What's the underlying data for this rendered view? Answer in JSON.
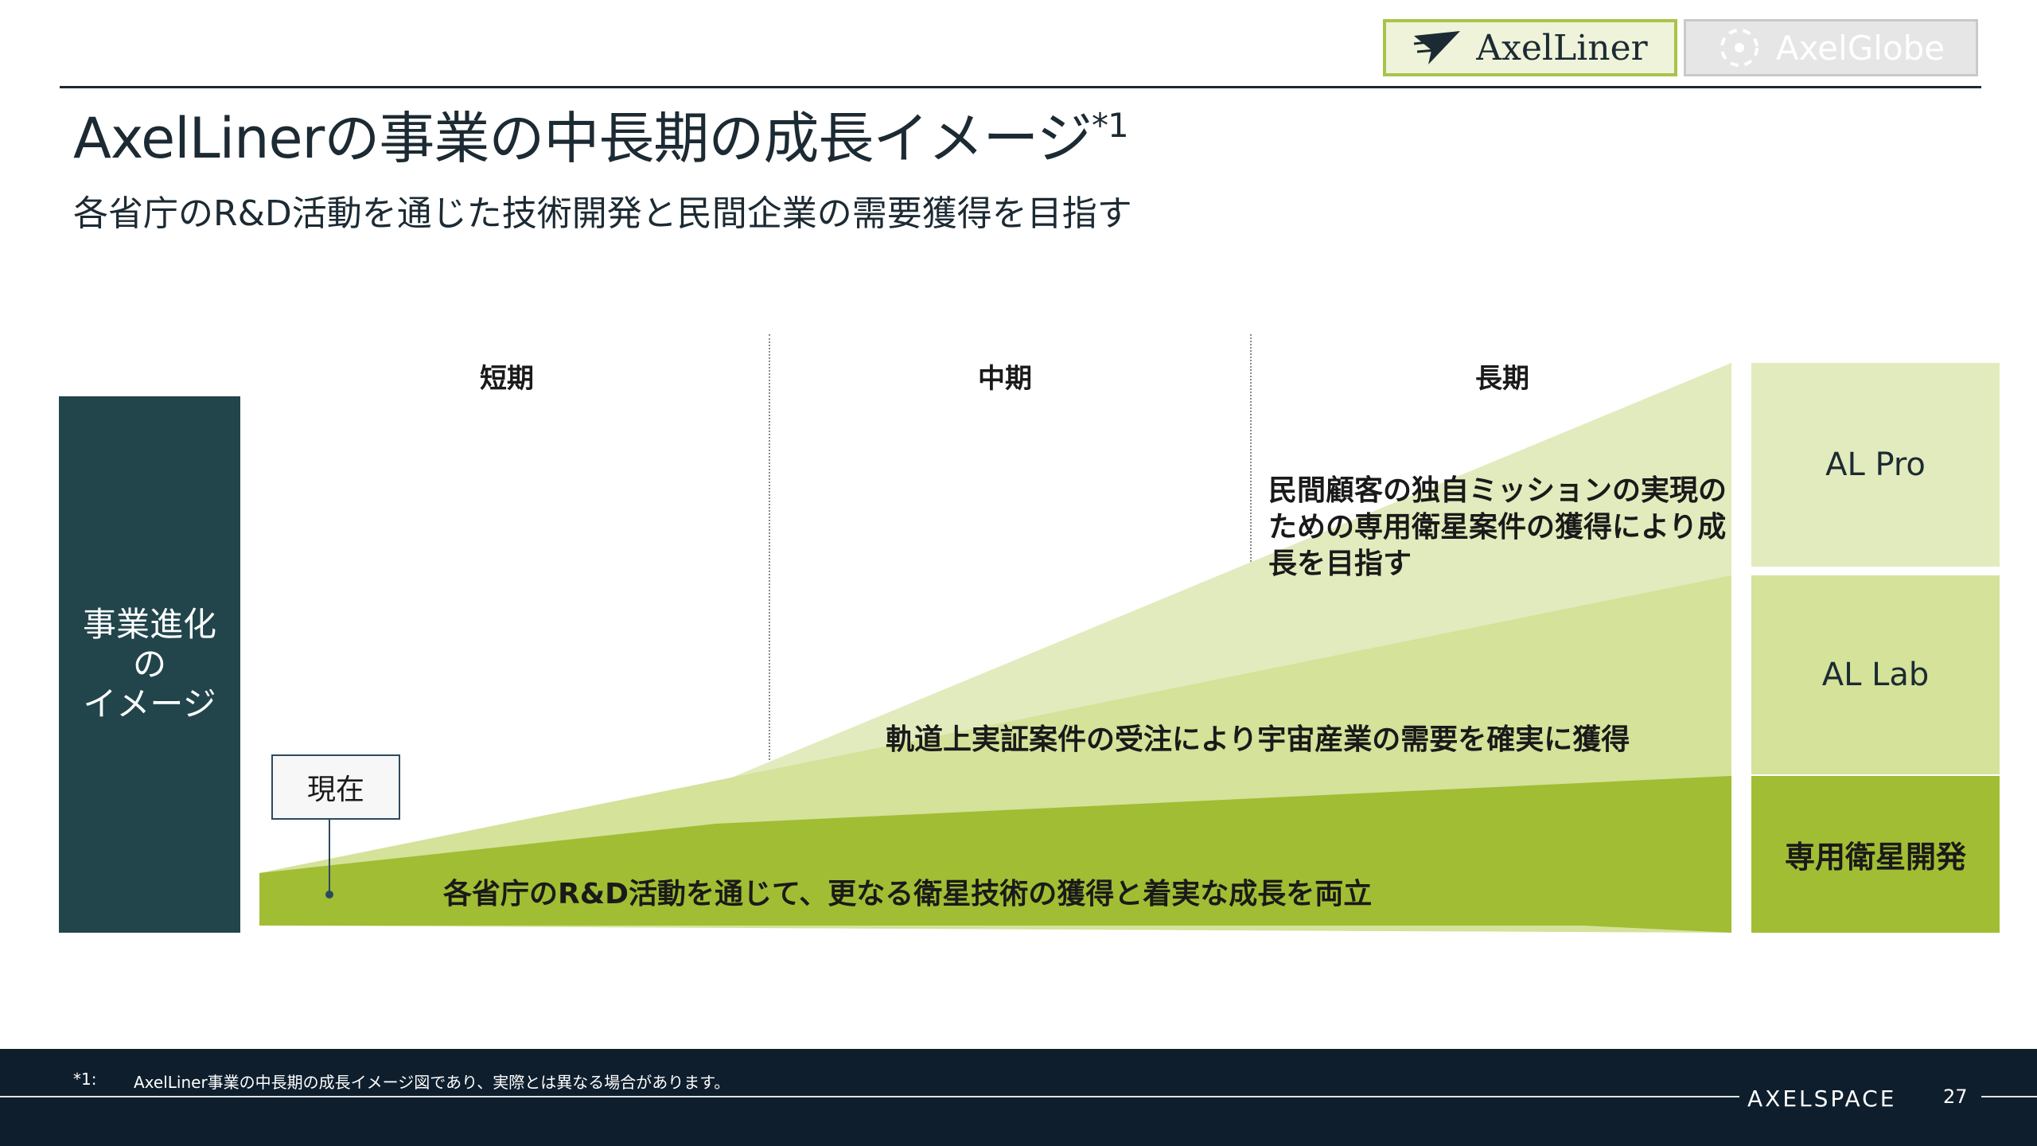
{
  "header": {
    "logo_primary": "AxelLiner",
    "logo_secondary": "AxelGlobe",
    "title": "AxelLinerの事業の中長期の成長イメージ",
    "title_note": "*1",
    "subtitle": "各省庁のR&D活動を通じた技術開発と民間企業の需要獲得を目指す"
  },
  "diagram": {
    "stage_label": "事業進化\nの\nイメージ",
    "periods": [
      "短期",
      "中期",
      "長期"
    ],
    "now_label": "現在",
    "bands": [
      {
        "name": "AL Pro",
        "description": "民間顧客の独自ミッションの実現の\nための専用衛星案件の獲得により成\n長を目指す",
        "color": "#e2ebbd"
      },
      {
        "name": "AL Lab",
        "description": "軌道上実証案件の受注により宇宙産業の需要を確実に獲得",
        "color": "#d4e29a"
      },
      {
        "name": "専用衛星開発",
        "description": "各省庁のR&D活動を通じて、更なる衛星技術の獲得と着実な成長を両立",
        "color": "#a1bd33"
      }
    ]
  },
  "footer": {
    "note_mark": "*1:",
    "note_text": "AxelLiner事業の中長期の成長イメージ図であり、実際とは異なる場合があります。",
    "brand": "AXELSPACE",
    "page_number": "27"
  }
}
